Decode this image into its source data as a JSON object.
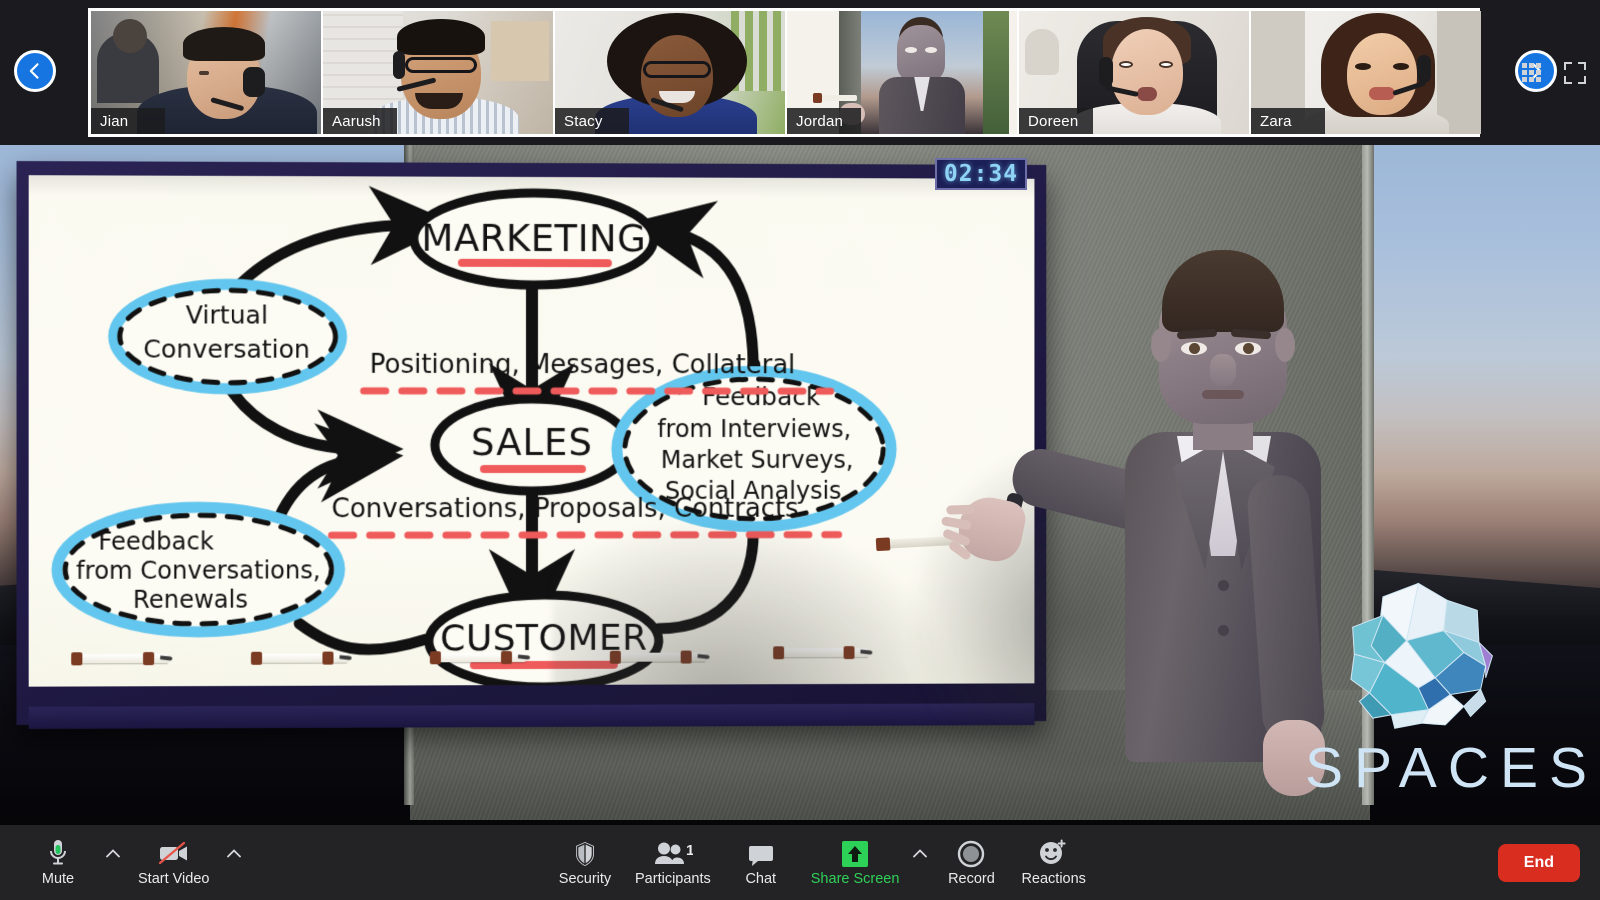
{
  "filmstrip": {
    "prev_label": "previous-participants",
    "next_label": "next-participants",
    "grid_view_label": "gallery-view",
    "fullscreen_label": "full-screen",
    "participants": [
      {
        "name": "Jian",
        "active": false
      },
      {
        "name": "Aarush",
        "active": false
      },
      {
        "name": "Stacy",
        "active": false
      },
      {
        "name": "Jordan",
        "active": true
      },
      {
        "name": "Doreen",
        "active": false
      },
      {
        "name": "Zara",
        "active": false
      }
    ]
  },
  "stage": {
    "timer": "02:34",
    "brand": "SPACES",
    "whiteboard": {
      "nodes": [
        {
          "id": "marketing",
          "label": "MARKETING"
        },
        {
          "id": "sales",
          "label": "SALES"
        },
        {
          "id": "customer",
          "label": "CUSTOMER"
        }
      ],
      "bubbles": [
        {
          "id": "virtual-conversation",
          "lines": [
            "Virtual",
            "Conversation"
          ]
        },
        {
          "id": "feedback-research",
          "lines": [
            "Feedback",
            "from Interviews,",
            "Market Surveys,",
            "Social Analysis"
          ]
        },
        {
          "id": "feedback-conversations",
          "lines": [
            "Feedback",
            "from Conversations,",
            "Renewals"
          ]
        }
      ],
      "edge_labels": [
        {
          "id": "marketing-to-sales",
          "text": "Positioning, Messages, Collateral"
        },
        {
          "id": "sales-to-customer",
          "text": "Conversations, Proposals, Contracts"
        }
      ]
    }
  },
  "toolbar": {
    "mute": {
      "label": "Mute",
      "icon": "microphone-icon"
    },
    "mute_menu": "audio-settings-menu",
    "video": {
      "label": "Start Video",
      "icon": "video-off-icon"
    },
    "video_menu": "video-settings-menu",
    "security": {
      "label": "Security",
      "icon": "shield-icon"
    },
    "participants": {
      "label": "Participants",
      "count": "1",
      "icon": "people-icon"
    },
    "chat": {
      "label": "Chat",
      "icon": "chat-bubble-icon"
    },
    "share_screen": {
      "label": "Share Screen",
      "icon": "share-up-arrow-icon"
    },
    "share_menu": "share-options-menu",
    "record": {
      "label": "Record",
      "icon": "record-circle-icon"
    },
    "reactions": {
      "label": "Reactions",
      "icon": "smiley-plus-icon"
    },
    "end": {
      "label": "End"
    }
  },
  "colors": {
    "accent_green": "#2ed158",
    "end_red": "#d92d20",
    "nav_blue": "#1675e0",
    "active_tile": "#d7e84d",
    "timer_text": "#8fd4f5",
    "bubble_blue": "#63c6ee",
    "underline_red": "#ef5a5a"
  }
}
